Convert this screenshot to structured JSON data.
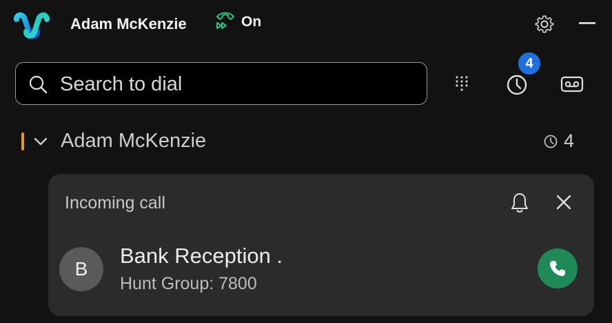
{
  "header": {
    "user_name": "Adam McKenzie",
    "status": "On",
    "icons": [
      "webex-logo",
      "call-forward-icon",
      "gear-icon",
      "minimize-icon"
    ]
  },
  "search": {
    "placeholder": "Search to dial"
  },
  "toolbar": {
    "history_badge": "4",
    "icons": [
      "dialpad-icon",
      "clock-icon",
      "voicemail-icon"
    ]
  },
  "group": {
    "name": "Adam McKenzie",
    "count": "4",
    "accent_color": "#e79a1f"
  },
  "incoming": {
    "title": "Incoming call",
    "avatar_initial": "B",
    "caller_name": "Bank Reception .",
    "caller_subtitle": "Hunt Group: 7800",
    "answer_color": "#1f8a57"
  }
}
